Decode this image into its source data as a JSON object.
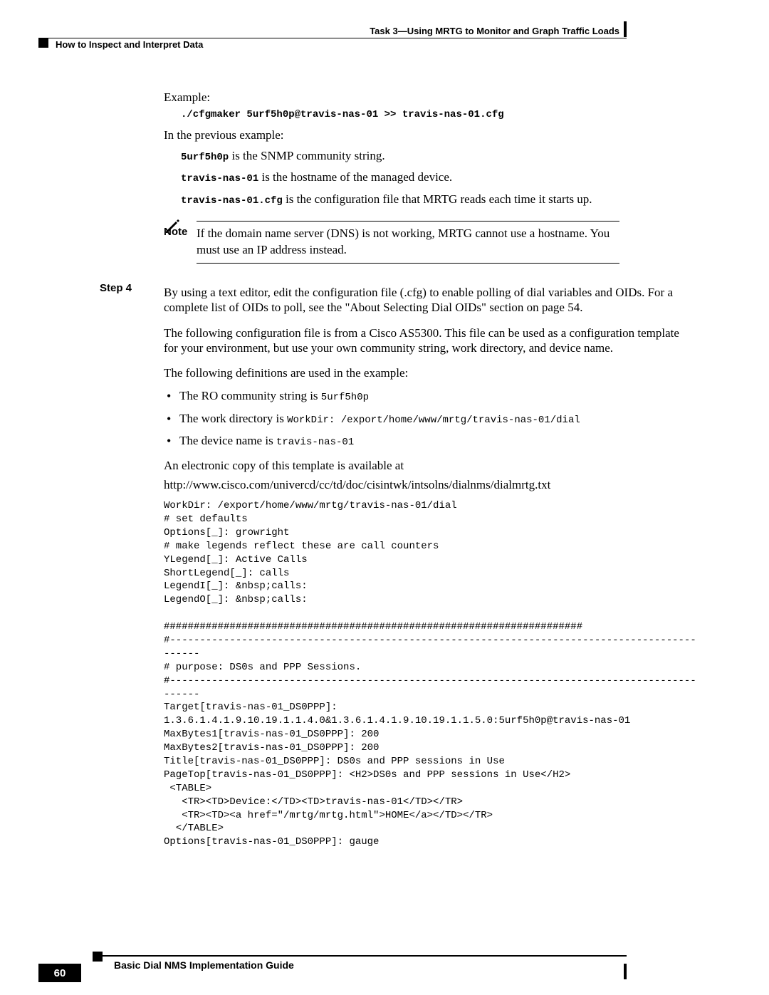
{
  "header": {
    "right": "Task 3—Using MRTG to Monitor and Graph Traffic Loads",
    "left": "How to Inspect and Interpret Data"
  },
  "example": {
    "label": "Example:",
    "cmd": "./cfgmaker 5urf5h0p@travis-nas-01 >> travis-nas-01.cfg",
    "prev_line": "In the previous example:",
    "bullets": {
      "b1_code": "5urf5h0p",
      "b1_text": " is the SNMP community string.",
      "b2_code": "travis-nas-01",
      "b2_text": " is the hostname of the managed device.",
      "b3_code": "travis-nas-01.cfg",
      "b3_text": " is the configuration file that MRTG reads each time it starts up."
    }
  },
  "note": {
    "label": "Note",
    "text": "If the domain name server (DNS) is not working, MRTG cannot use a hostname. You must use an IP address instead."
  },
  "step": {
    "label": "Step 4",
    "p1": "By using a text editor, edit the configuration file (.cfg) to enable polling of dial variables and OIDs. For a complete list of OIDs to poll, see the \"About Selecting Dial OIDs\" section on page 54.",
    "p2": "The following configuration file is from a Cisco AS5300. This file can be used as a configuration template for your environment, but use your own community string, work directory, and device name.",
    "p3": "The following definitions are used in the example:",
    "defs": {
      "d1_pre": "The RO community string is ",
      "d1_mono": "5urf5h0p",
      "d2_pre": "The work directory is ",
      "d2_mono": "WorkDir: /export/home/www/mrtg/travis-nas-01/dial",
      "d3_pre": "The device name is ",
      "d3_mono": "travis-nas-01"
    },
    "p4a": "An electronic copy of this template is available at",
    "p4b": "http://www.cisco.com/univercd/cc/td/doc/cisintwk/intsolns/dialnms/dialmrtg.txt"
  },
  "codeblock": "WorkDir: /export/home/www/mrtg/travis-nas-01/dial\n# set defaults\nOptions[_]: growright\n# make legends reflect these are call counters\nYLegend[_]: Active Calls\nShortLegend[_]: calls\nLegendI[_]: &nbsp;calls:\nLegendO[_]: &nbsp;calls:\n\n######################################################################\n#----------------------------------------------------------------------------------------\n------\n# purpose: DS0s and PPP Sessions.\n#----------------------------------------------------------------------------------------\n------\nTarget[travis-nas-01_DS0PPP]: \n1.3.6.1.4.1.9.10.19.1.1.4.0&1.3.6.1.4.1.9.10.19.1.1.5.0:5urf5h0p@travis-nas-01\nMaxBytes1[travis-nas-01_DS0PPP]: 200\nMaxBytes2[travis-nas-01_DS0PPP]: 200\nTitle[travis-nas-01_DS0PPP]: DS0s and PPP sessions in Use\nPageTop[travis-nas-01_DS0PPP]: <H2>DS0s and PPP sessions in Use</H2>\n <TABLE>\n   <TR><TD>Device:</TD><TD>travis-nas-01</TD></TR>\n   <TR><TD><a href=\"/mrtg/mrtg.html\">HOME</a></TD></TR>\n  </TABLE>\nOptions[travis-nas-01_DS0PPP]: gauge",
  "footer": {
    "title": "Basic Dial NMS Implementation Guide",
    "page_number": "60"
  }
}
